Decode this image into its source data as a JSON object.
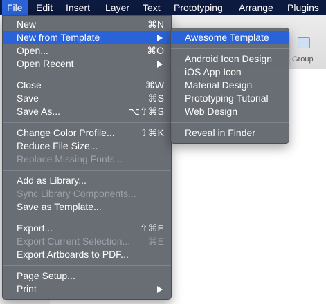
{
  "menubar": {
    "items": [
      "File",
      "Edit",
      "Insert",
      "Layer",
      "Text",
      "Prototyping",
      "Arrange",
      "Plugins"
    ]
  },
  "toolbar": {
    "group_label": "Group"
  },
  "file_menu": {
    "items": [
      {
        "label": "New",
        "shortcut": "⌘N"
      },
      {
        "label": "New from Template",
        "shortcut": ""
      },
      {
        "label": "Open...",
        "shortcut": "⌘O"
      },
      {
        "label": "Open Recent",
        "shortcut": ""
      },
      {
        "label": "Close",
        "shortcut": "⌘W"
      },
      {
        "label": "Save",
        "shortcut": "⌘S"
      },
      {
        "label": "Save As...",
        "shortcut": "⌥⇧⌘S"
      },
      {
        "label": "Change Color Profile...",
        "shortcut": "⇧⌘K"
      },
      {
        "label": "Reduce File Size...",
        "shortcut": ""
      },
      {
        "label": "Replace Missing Fonts...",
        "shortcut": ""
      },
      {
        "label": "Add as Library...",
        "shortcut": ""
      },
      {
        "label": "Sync Library Components...",
        "shortcut": ""
      },
      {
        "label": "Save as Template...",
        "shortcut": ""
      },
      {
        "label": "Export...",
        "shortcut": "⇧⌘E"
      },
      {
        "label": "Export Current Selection...",
        "shortcut": "⌘E"
      },
      {
        "label": "Export Artboards to PDF...",
        "shortcut": ""
      },
      {
        "label": "Page Setup...",
        "shortcut": ""
      },
      {
        "label": "Print",
        "shortcut": ""
      }
    ]
  },
  "template_menu": {
    "items": [
      {
        "label": "Awesome Template"
      },
      {
        "label": "Android Icon Design"
      },
      {
        "label": "iOS App Icon"
      },
      {
        "label": "Material Design"
      },
      {
        "label": "Prototyping Tutorial"
      },
      {
        "label": "Web Design"
      },
      {
        "label": "Reveal in Finder"
      }
    ]
  },
  "colors": {
    "highlight": "#2a62d8",
    "menubar": "#0c1a3f",
    "menu_bg": "#64686f",
    "disabled": "#9da1a9"
  }
}
